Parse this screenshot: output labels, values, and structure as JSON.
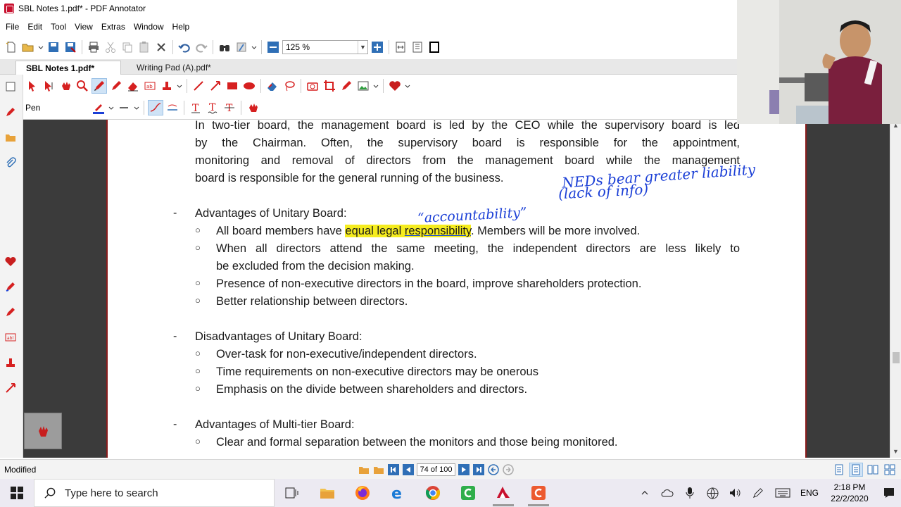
{
  "window": {
    "title": "SBL Notes 1.pdf* - PDF Annotator"
  },
  "menu": [
    "File",
    "Edit",
    "Tool",
    "View",
    "Extras",
    "Window",
    "Help"
  ],
  "toolbar": {
    "zoom": "125 %"
  },
  "tabs": [
    {
      "label": "SBL Notes 1.pdf*",
      "active": true
    },
    {
      "label": "Writing Pad (A).pdf*",
      "active": false
    }
  ],
  "annotation_toolbar": {
    "tool_label": "Pen",
    "pen_color": "#1b3fd6"
  },
  "document": {
    "intro_lines": [
      "In two-tier board, the management board is led by the CEO while the supervisory board is led",
      "by the Chairman. Often, the supervisory board is responsible for the appointment,",
      "monitoring and removal of directors from the management board while the management",
      "board is responsible for the general running of the business."
    ],
    "sections": [
      {
        "bullet": "-",
        "heading": "Advantages of Unitary Board:",
        "items": [
          {
            "pre": "All board members have ",
            "highlight1": "equal legal ",
            "highlight2": "responsibility",
            "post": ". Members will be more involved."
          },
          {
            "line1": "When all directors attend the same meeting, the independent directors are less likely to",
            "line2": "be excluded from the decision making."
          },
          {
            "text": "Presence of non-executive directors in the board, improve shareholders protection."
          },
          {
            "text": "Better relationship between directors."
          }
        ]
      },
      {
        "bullet": "-",
        "heading": "Disadvantages of Unitary Board:",
        "items": [
          {
            "text": "Over-task for non-executive/independent directors."
          },
          {
            "text": "Time requirements on non-executive directors may be onerous"
          },
          {
            "text": "Emphasis on the divide between shareholders and directors."
          }
        ]
      },
      {
        "bullet": "-",
        "heading": "Advantages of Multi-tier Board:",
        "items": [
          {
            "text": "Clear and formal separation between the monitors and those being monitored."
          }
        ]
      }
    ],
    "sub_bullet": "○",
    "handwriting": {
      "note1": "NEDs bear greater liability",
      "note2": "(lack of info)",
      "note3": "“accountability”"
    }
  },
  "status": {
    "left": "Modified",
    "page_indicator": "74 of 100"
  },
  "taskbar": {
    "search_placeholder": "Type here to search",
    "language": "ENG",
    "time": "2:18 PM",
    "date": "22/2/2020"
  }
}
